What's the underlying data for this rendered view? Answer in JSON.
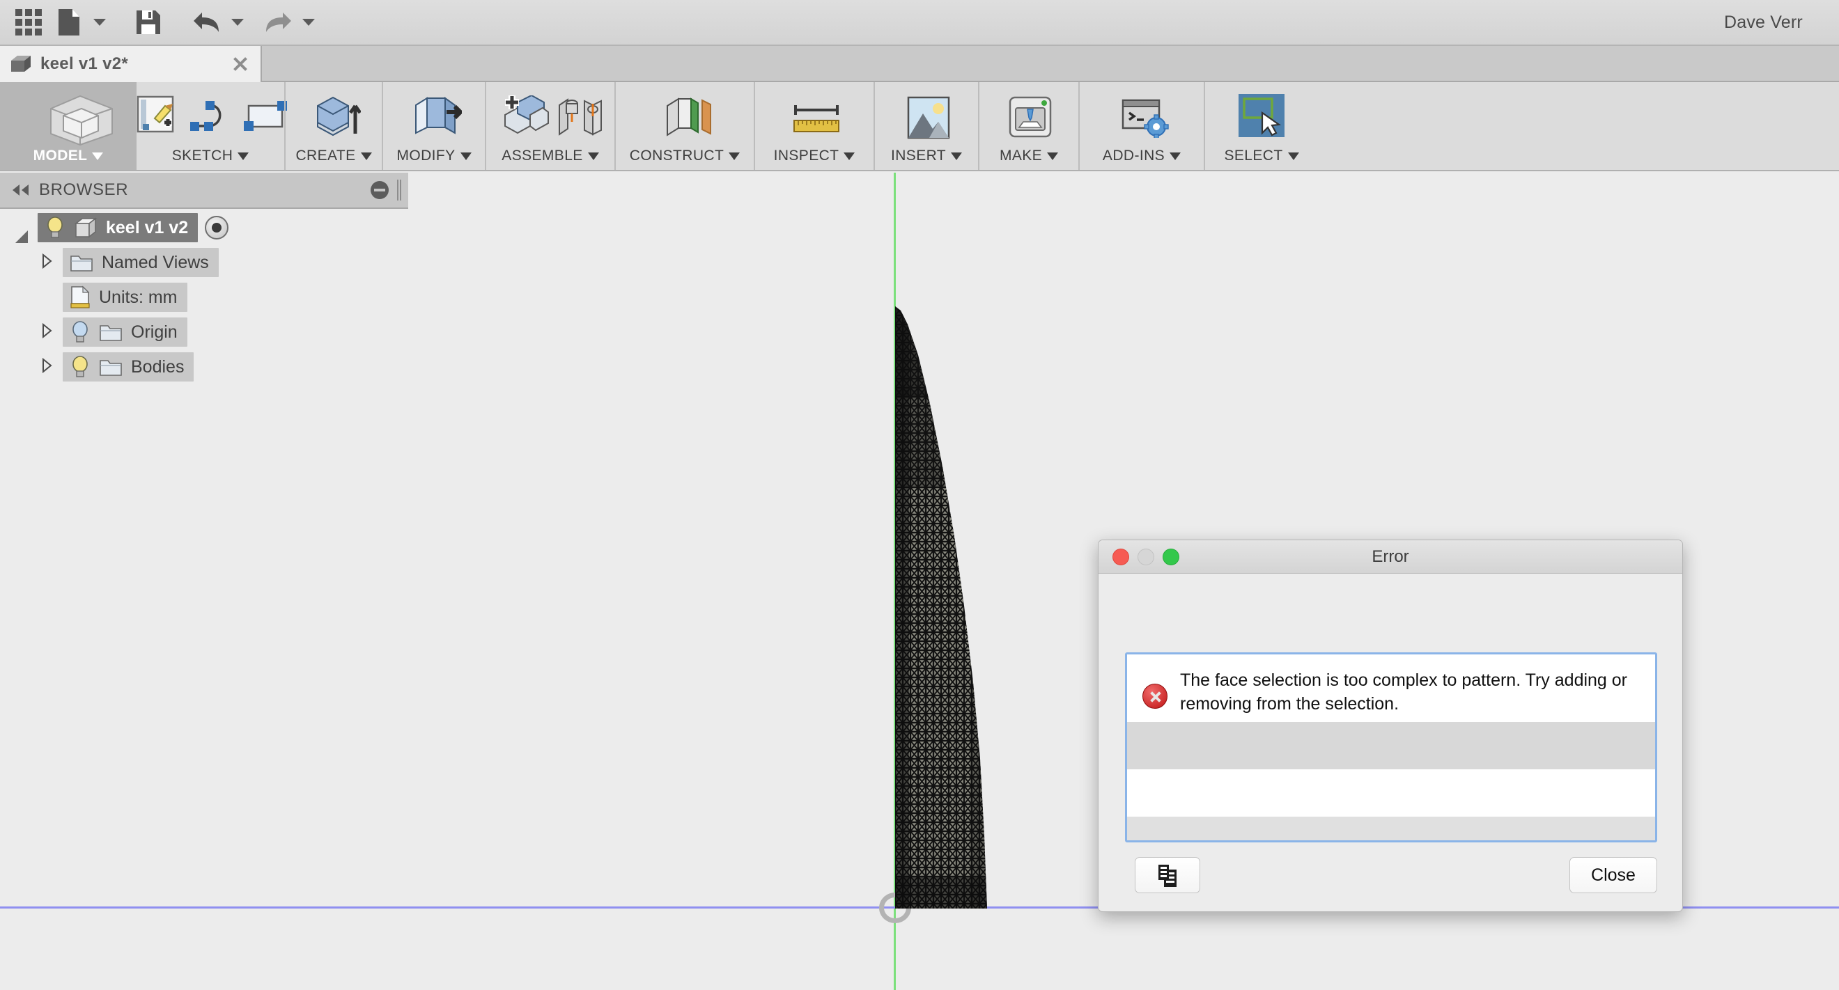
{
  "appbar": {
    "grid_icon": "grid-apps-icon",
    "new_file_icon": "new-file-icon",
    "save_icon": "save-icon",
    "undo_icon": "undo-icon",
    "redo_icon": "redo-icon",
    "user_name": "Dave Verr"
  },
  "tab": {
    "title": "keel v1 v2*",
    "doc_icon": "document-cube-icon",
    "close_icon": "close-icon"
  },
  "ribbon": {
    "groups": [
      {
        "label": "MODEL",
        "active": true,
        "icons": [
          "workspace-cube-icon"
        ]
      },
      {
        "label": "SKETCH",
        "active": false,
        "icons": [
          "create-sketch-icon",
          "spline-icon",
          "rectangle-icon"
        ]
      },
      {
        "label": "CREATE",
        "active": false,
        "icons": [
          "extrude-icon"
        ]
      },
      {
        "label": "MODIFY",
        "active": false,
        "icons": [
          "press-pull-icon"
        ]
      },
      {
        "label": "ASSEMBLE",
        "active": false,
        "icons": [
          "new-component-icon",
          "joint-icon"
        ]
      },
      {
        "label": "CONSTRUCT",
        "active": false,
        "icons": [
          "offset-plane-icon"
        ]
      },
      {
        "label": "INSPECT",
        "active": false,
        "icons": [
          "measure-ruler-icon"
        ]
      },
      {
        "label": "INSERT",
        "active": false,
        "icons": [
          "insert-image-icon"
        ]
      },
      {
        "label": "MAKE",
        "active": false,
        "icons": [
          "3d-print-icon"
        ]
      },
      {
        "label": "ADD-INS",
        "active": false,
        "icons": [
          "script-console-gear-icon"
        ]
      },
      {
        "label": "SELECT",
        "active": false,
        "icons": [
          "select-cursor-icon"
        ]
      }
    ]
  },
  "browser": {
    "title": "BROWSER",
    "collapse_icon": "collapse-left-icon",
    "minimize_icon": "minimize-icon",
    "tree": [
      {
        "label": "keel v1 v2",
        "selected": true,
        "twisty": "open",
        "bulb": "yellow",
        "icon": "component-cube-icon",
        "trailing": "eyeball-icon"
      },
      {
        "label": "Named Views",
        "selected": false,
        "twisty": "closed",
        "bulb": "none",
        "icon": "folder-icon",
        "trailing": "none"
      },
      {
        "label": "Units: mm",
        "selected": false,
        "twisty": "none",
        "bulb": "none",
        "icon": "units-document-icon",
        "trailing": "none"
      },
      {
        "label": "Origin",
        "selected": false,
        "twisty": "closed",
        "bulb": "blue",
        "icon": "folder-icon",
        "trailing": "none"
      },
      {
        "label": "Bodies",
        "selected": false,
        "twisty": "closed",
        "bulb": "yellow",
        "icon": "folder-icon",
        "trailing": "none"
      }
    ]
  },
  "canvas": {
    "vertical_axis_color": "#7ce07c",
    "horizontal_axis_color": "#8f8ff0",
    "background_color": "#ececec",
    "origin_marker": "origin-point-icon",
    "model_name": "keel-mesh-body"
  },
  "dialog": {
    "title": "Error",
    "traffic_lights": [
      "close-button",
      "minimize-button",
      "zoom-button"
    ],
    "error_icon": "error-icon",
    "message": "The face selection is too complex to pattern. Try adding or removing from the selection.",
    "copy_icon": "copy-to-clipboard-icon",
    "close_label": "Close"
  }
}
